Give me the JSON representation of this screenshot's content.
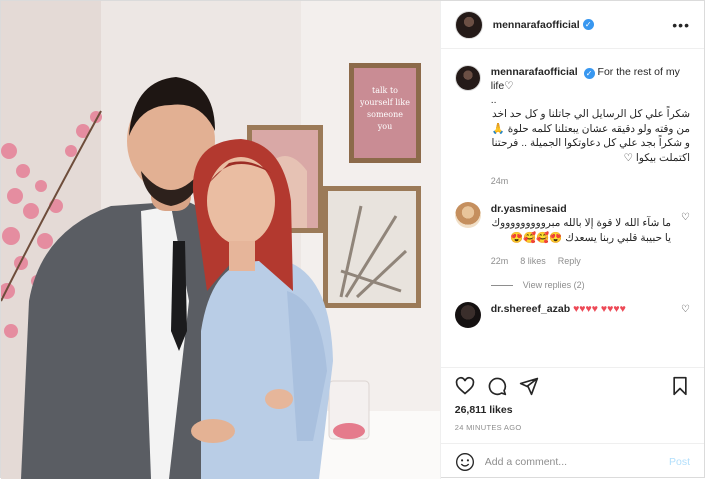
{
  "post": {
    "username": "mennarafaofficial",
    "more_label": "•••",
    "verified_mark": "✓"
  },
  "caption": {
    "username": "mennarafaofficial",
    "english": "For the rest of my life♡",
    "dots": "..",
    "arabic": "شكراً علي كل الرسايل الي جاتلنا و كل حد اخد من وقته ولو دقيقه عشان يبعتلنا كلمه حلوة 🙏 و شكراً بجد علي كل دعاوتكوا الجميلة .. فرحتنا اكتملت بيكوا ♡",
    "time": "24m"
  },
  "comments": [
    {
      "username": "dr.yasminesaid",
      "text": "ما شآء الله لا قوة إلا بالله مبروووووووووك يا حبيبة قلبي ربنا يسعدك 😍🥰🥰😍",
      "time": "22m",
      "likes": "8 likes",
      "reply": "Reply",
      "view_replies": "View replies (2)"
    },
    {
      "username": "dr.shereef_azab",
      "text": "♥♥♥♥ ♥♥♥♥"
    }
  ],
  "stats": {
    "likes": "26,811 likes",
    "posted": "24 MINUTES AGO"
  },
  "composer": {
    "placeholder": "Add a comment...",
    "post_label": "Post"
  },
  "photo": {
    "poster_text": "talk to yourself like someone you"
  },
  "icons": [
    "verified-badge-icon",
    "more-options-icon",
    "heart-icon",
    "comment-icon",
    "share-icon",
    "bookmark-icon",
    "emoji-icon"
  ],
  "colors": {
    "accent": "#3897f0",
    "muted": "#8e8e8e",
    "post_disabled": "#b2dffc",
    "heart_red": "#ed4956"
  }
}
